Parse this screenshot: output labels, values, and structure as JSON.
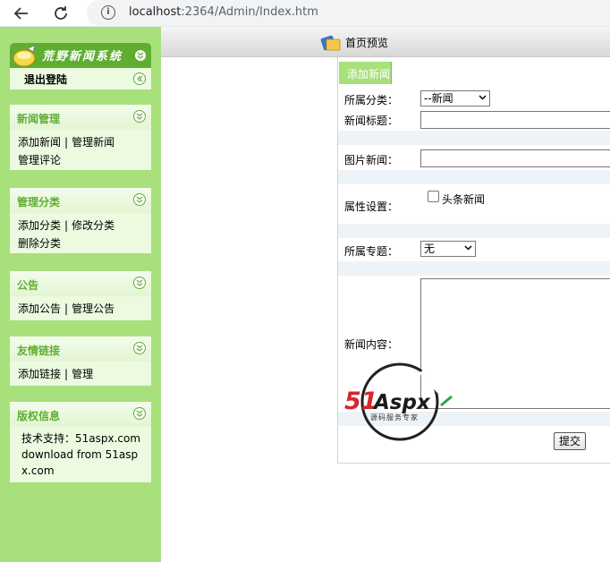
{
  "browser": {
    "url_host": "localhost",
    "url_rest": ":2364/Admin/Index.htm"
  },
  "sidebar": {
    "logo_text": "荒野新闻系统",
    "logout_label": "退出登陆",
    "panels": [
      {
        "title": "新闻管理",
        "links": [
          "添加新闻",
          "管理新闻",
          "管理评论"
        ]
      },
      {
        "title": "管理分类",
        "links": [
          "添加分类",
          "修改分类",
          "删除分类"
        ]
      },
      {
        "title": "公告",
        "links": [
          "添加公告",
          "管理公告"
        ]
      },
      {
        "title": "友情链接",
        "links": [
          "添加链接",
          "管理"
        ]
      },
      {
        "title": "版权信息",
        "lines": [
          "技术支持：51aspx.com",
          "download from 51asp",
          "x.com"
        ]
      }
    ],
    "separator": "|"
  },
  "header": {
    "title": "首页预览"
  },
  "tab": {
    "label": "添加新闻"
  },
  "form": {
    "category_label": "所属分类：",
    "category_value": "--新闻",
    "title_label": "新闻标题：",
    "title_value": "",
    "image_label": "图片新闻：",
    "image_value": "",
    "attr_label": "属性设置：",
    "headline_label": "头条新闻",
    "headline_checked": false,
    "topic_label": "所属专题：",
    "topic_value": "无",
    "content_label": "新闻内容：",
    "content_value": "",
    "submit_label": "提交"
  },
  "watermark": {
    "brand_prefix": "51",
    "brand_suffix": "Aspx",
    "tagline": "源码服务专家"
  },
  "colors": {
    "sidebar_bg": "#a8e07c",
    "accent_green": "#5fae32",
    "panel_bg": "#ecfae0",
    "watermark_red": "#d8262c",
    "watermark_green": "#2aa845"
  }
}
